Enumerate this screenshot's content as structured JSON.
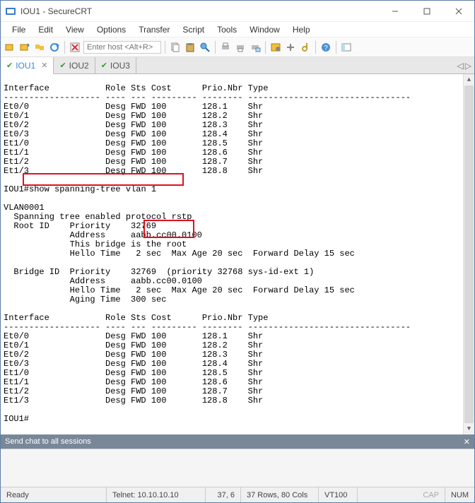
{
  "window": {
    "title": "IOU1 - SecureCRT"
  },
  "menus": [
    "File",
    "Edit",
    "View",
    "Options",
    "Transfer",
    "Script",
    "Tools",
    "Window",
    "Help"
  ],
  "host_placeholder": "Enter host <Alt+R>",
  "tabs": [
    {
      "label": "IOU1",
      "active": true,
      "closeable": true
    },
    {
      "label": "IOU2",
      "active": false,
      "closeable": false
    },
    {
      "label": "IOU3",
      "active": false,
      "closeable": false
    }
  ],
  "terminal": {
    "header1": "Interface           Role Sts Cost      Prio.Nbr Type",
    "dash1": "------------------- ---- --- --------- -------- --------------------------------",
    "rows1": [
      "Et0/0               Desg FWD 100       128.1    Shr",
      "Et0/1               Desg FWD 100       128.2    Shr",
      "Et0/2               Desg FWD 100       128.3    Shr",
      "Et0/3               Desg FWD 100       128.4    Shr",
      "Et1/0               Desg FWD 100       128.5    Shr",
      "Et1/1               Desg FWD 100       128.6    Shr",
      "Et1/2               Desg FWD 100       128.7    Shr",
      "Et1/3               Desg FWD 100       128.8    Shr"
    ],
    "cmd_prompt": "IOU1#",
    "cmd": "show spanning-tree vlan 1",
    "vlan_name": "VLAN0001",
    "proto": "  Spanning tree enabled protocol rstp",
    "rootid": "  Root ID    Priority    32769",
    "rootaddr": "             Address     aabb.cc00.0100",
    "rootmsg": "             This bridge is the root",
    "roothello": "             Hello Time   2 sec  Max Age 20 sec  Forward Delay 15 sec",
    "bridgeid": "  Bridge ID  Priority    32769  (priority 32768 sys-id-ext 1)",
    "bridgeaddr": "             Address     aabb.cc00.0100",
    "bridgehello": "             Hello Time   2 sec  Max Age 20 sec  Forward Delay 15 sec",
    "aging": "             Aging Time  300 sec",
    "header2": "Interface           Role Sts Cost      Prio.Nbr Type",
    "dash2": "------------------- ---- --- --------- -------- --------------------------------",
    "rows2": [
      "Et0/0               Desg FWD 100       128.1    Shr",
      "Et0/1               Desg FWD 100       128.2    Shr",
      "Et0/2               Desg FWD 100       128.3    Shr",
      "Et0/3               Desg FWD 100       128.4    Shr",
      "Et1/0               Desg FWD 100       128.5    Shr",
      "Et1/1               Desg FWD 100       128.6    Shr",
      "Et1/2               Desg FWD 100       128.7    Shr",
      "Et1/3               Desg FWD 100       128.8    Shr"
    ],
    "prompt2": "IOU1#"
  },
  "chat_label": "Send chat to all sessions",
  "status": {
    "ready": "Ready",
    "conn": "Telnet: 10.10.10.10",
    "cursor": "37,  6",
    "dims": "37 Rows, 80 Cols",
    "term": "VT100",
    "cap": "CAP",
    "num": "NUM"
  }
}
